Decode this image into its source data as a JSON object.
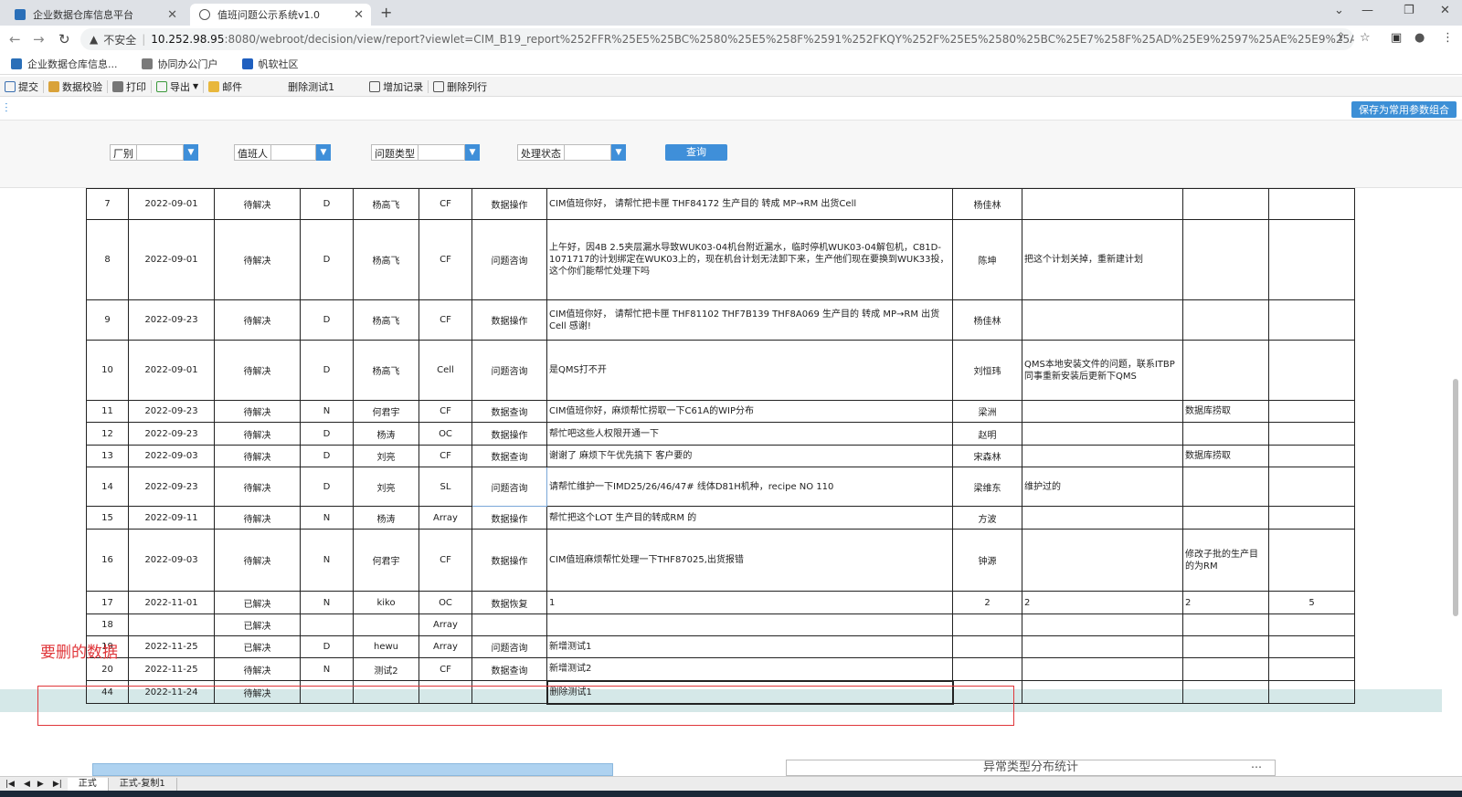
{
  "browser": {
    "tabs": [
      {
        "title": "企业数据仓库信息平台",
        "active": false
      },
      {
        "title": "值班问题公示系统v1.0",
        "active": true
      }
    ],
    "address": {
      "security": "不安全",
      "host": "10.252.98.95",
      "path": ":8080/webroot/decision/view/report?viewlet=CIM_B19_report%252FFR%25E5%25BC%2580%25E5%258F%2591%252FKQY%252F%25E5%2580%25BC%25E7%258F%25AD%25E9%2597%25AE%25E9%25A2%2598%25..."
    },
    "bookmarks": [
      "企业数据仓库信息...",
      "协同办公门户",
      "帆软社区"
    ]
  },
  "toolbar": {
    "items": [
      "提交",
      "数据校验",
      "打印",
      "导出",
      "邮件",
      "删除测试1",
      "增加记录",
      "删除列行"
    ]
  },
  "params": {
    "save_label": "保存为常用参数组合",
    "fields": [
      "厂别",
      "值班人",
      "问题类型",
      "处理状态"
    ],
    "query_label": "查询"
  },
  "table": {
    "rows": [
      [
        "7",
        "2022-09-01",
        "待解决",
        "D",
        "杨高飞",
        "CF",
        "数据操作",
        "CIM值班你好， 请帮忙把卡匣 THF84172 生产目的 转成 MP→RM 出货Cell",
        "杨佳林",
        "",
        "",
        ""
      ],
      [
        "8",
        "2022-09-01",
        "待解决",
        "D",
        "杨高飞",
        "CF",
        "问题咨询",
        "上午好，因4B 2.5夹层漏水导致WUK03-04机台附近漏水，临时停机WUK03-04解包机，C81D-1071717的计划绑定在WUK03上的，现在机台计划无法卸下来，生产他们现在要换到WUK33投，这个你们能帮忙处理下吗",
        "陈坤",
        "把这个计划关掉，重新建计划",
        "",
        ""
      ],
      [
        "9",
        "2022-09-23",
        "待解决",
        "D",
        "杨高飞",
        "CF",
        "数据操作",
        "CIM值班你好， 请帮忙把卡匣 THF81102 THF7B139 THF8A069 生产目的 转成 MP→RM 出货Cell 感谢!",
        "杨佳林",
        "",
        "",
        ""
      ],
      [
        "10",
        "2022-09-01",
        "待解决",
        "D",
        "杨高飞",
        "Cell",
        "问题咨询",
        "是QMS打不开",
        "刘恒玮",
        "QMS本地安装文件的问题，联系ITBP同事重新安装后更新下QMS",
        "",
        ""
      ],
      [
        "11",
        "2022-09-23",
        "待解决",
        "N",
        "何君宇",
        "CF",
        "数据查询",
        "CIM值班你好，麻烦帮忙捞取一下C61A的WIP分布",
        "梁洲",
        "",
        "数据库捞取",
        ""
      ],
      [
        "12",
        "2022-09-23",
        "待解决",
        "D",
        "杨涛",
        "OC",
        "数据操作",
        "帮忙吧这些人权限开通一下",
        "赵明",
        "",
        "",
        ""
      ],
      [
        "13",
        "2022-09-03",
        "待解决",
        "D",
        "刘亮",
        "CF",
        "数据查询",
        "谢谢了 麻烦下午优先搞下 客户要的",
        "宋森林",
        "",
        "数据库捞取",
        ""
      ],
      [
        "14",
        "2022-09-23",
        "待解决",
        "D",
        "刘亮",
        "SL",
        "问题咨询",
        "请帮忙维护一下IMD25/26/46/47# 线体D81H机种，recipe NO 110",
        "梁维东",
        "维护过的",
        "",
        ""
      ],
      [
        "15",
        "2022-09-11",
        "待解决",
        "N",
        "杨涛",
        "Array",
        "数据操作",
        "帮忙把这个LOT 生产目的转成RM 的",
        "方波",
        "",
        "",
        ""
      ],
      [
        "16",
        "2022-09-03",
        "待解决",
        "N",
        "何君宇",
        "CF",
        "数据操作",
        "CIM值班麻烦帮忙处理一下THF87025,出货报错",
        "钟源",
        "",
        "修改子批的生产目的为RM",
        ""
      ],
      [
        "17",
        "2022-11-01",
        "已解决",
        "N",
        "kiko",
        "OC",
        "数据恢复",
        "1",
        "2",
        "2",
        "2",
        "5"
      ],
      [
        "18",
        "",
        "已解决",
        "",
        "",
        "Array",
        "",
        "",
        "",
        "",
        "",
        ""
      ],
      [
        "19",
        "2022-11-25",
        "已解决",
        "D",
        "hewu",
        "Array",
        "问题咨询",
        "新增测试1",
        "",
        "",
        "",
        ""
      ],
      [
        "20",
        "2022-11-25",
        "待解决",
        "N",
        "测试2",
        "CF",
        "数据查询",
        "新增测试2",
        "",
        "",
        "",
        ""
      ],
      [
        "44",
        "2022-11-24",
        "待解决",
        "",
        "",
        "",
        "",
        "删除测试1",
        "",
        "",
        "",
        ""
      ]
    ]
  },
  "annotation": {
    "text": "要删的数据",
    "color": "#e0363a"
  },
  "sheets": [
    "正式",
    "正式-复制1"
  ],
  "bottom": {
    "left_title": "",
    "right_title": "异常类型分布统计"
  },
  "colors": {
    "accent": "#3f8fd9",
    "highlight_row": "#d5e8e8"
  }
}
